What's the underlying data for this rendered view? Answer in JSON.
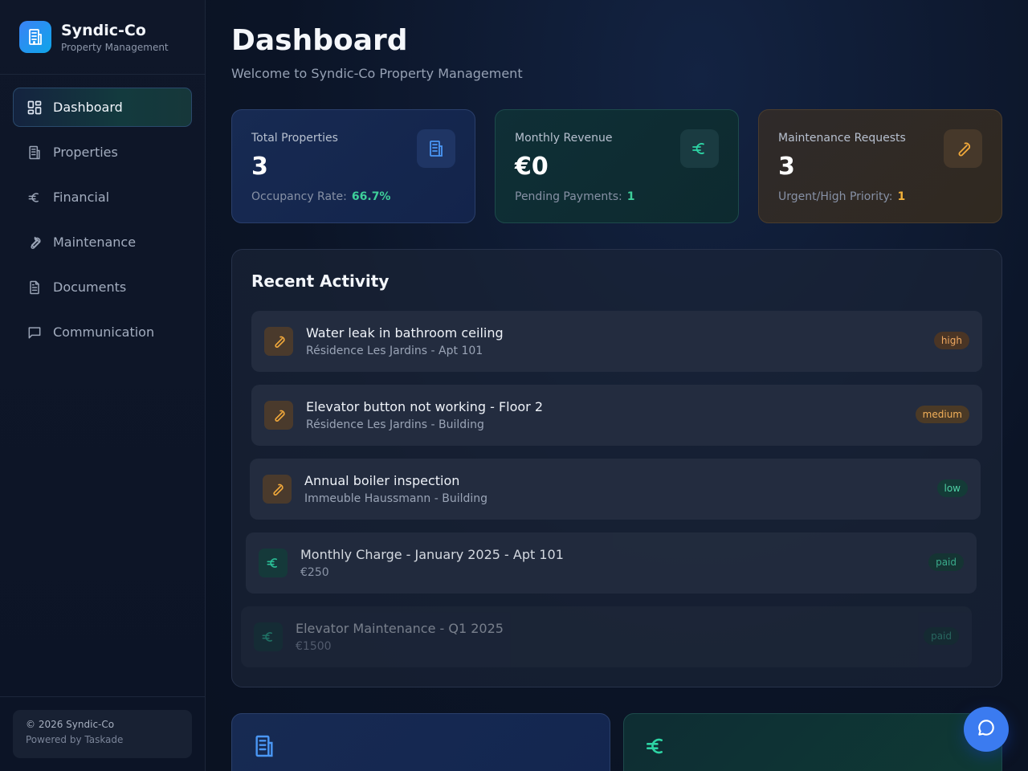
{
  "brand": {
    "name": "Syndic-Co",
    "subtitle": "Property Management"
  },
  "nav": [
    {
      "label": "Dashboard",
      "icon": "grid-icon",
      "active": true
    },
    {
      "label": "Properties",
      "icon": "building-icon"
    },
    {
      "label": "Financial",
      "icon": "euro-icon"
    },
    {
      "label": "Maintenance",
      "icon": "wrench-icon"
    },
    {
      "label": "Documents",
      "icon": "document-icon"
    },
    {
      "label": "Communication",
      "icon": "message-icon"
    }
  ],
  "footer": {
    "copyright": "© 2026 Syndic-Co",
    "powered": "Powered by Taskade"
  },
  "header": {
    "title": "Dashboard",
    "subtitle": "Welcome to Syndic-Co Property Management"
  },
  "stats": {
    "properties": {
      "label": "Total Properties",
      "value": "3",
      "foot_label": "Occupancy Rate:",
      "foot_value": "66.7%",
      "accent": "#3ecf9a"
    },
    "revenue": {
      "label": "Monthly Revenue",
      "value": "€0",
      "foot_label": "Pending Payments:",
      "foot_value": "1",
      "accent": "#3ecf9a"
    },
    "maintenance": {
      "label": "Maintenance Requests",
      "value": "3",
      "foot_label": "Urgent/High Priority:",
      "foot_value": "1",
      "accent": "#f2b13a"
    }
  },
  "activity": {
    "title": "Recent Activity",
    "items": [
      {
        "title": "Water leak in bathroom ceiling",
        "subtitle": "Résidence Les Jardins - Apt 101",
        "badge": "high",
        "icon": "wrench-icon"
      },
      {
        "title": "Elevator button not working - Floor 2",
        "subtitle": "Résidence Les Jardins - Building",
        "badge": "medium",
        "icon": "wrench-icon"
      },
      {
        "title": "Annual boiler inspection",
        "subtitle": "Immeuble Haussmann - Building",
        "badge": "low",
        "icon": "wrench-icon"
      },
      {
        "title": "Monthly Charge - January 2025 - Apt 101",
        "subtitle": "€250",
        "badge": "paid",
        "icon": "euro-icon"
      },
      {
        "title": "Elevator Maintenance - Q1 2025",
        "subtitle": "€1500",
        "badge": "paid",
        "icon": "euro-icon"
      }
    ]
  },
  "colors": {
    "accent_blue": "#3b82f6",
    "accent_teal": "#2dd4a4",
    "accent_amber": "#f2a93b"
  }
}
